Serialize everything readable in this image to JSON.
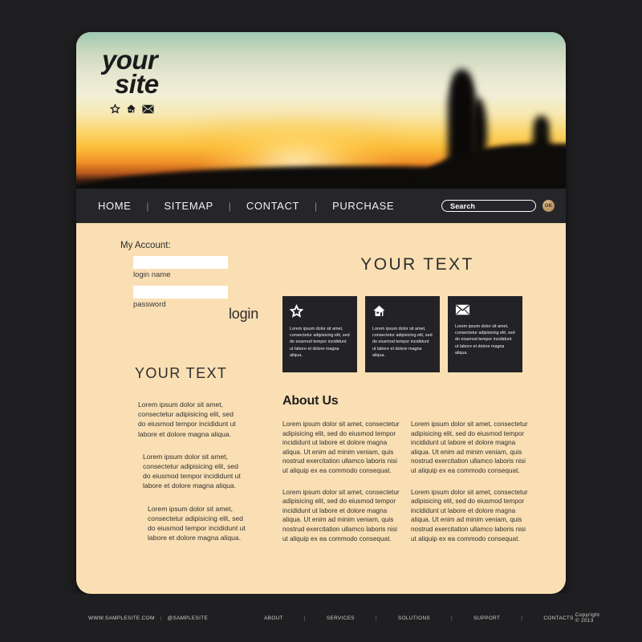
{
  "brand": {
    "line1": "your",
    "line2": "site",
    "icons": [
      "star-icon",
      "house-icon",
      "envelope-icon"
    ]
  },
  "nav": {
    "items": [
      "HOME",
      "SITEMAP",
      "CONTACT",
      "PURCHASE"
    ],
    "separator": "|",
    "search_placeholder": "Search",
    "ok_label": "OK"
  },
  "account": {
    "title": "My Account:",
    "login_value": "",
    "login_label": "login name",
    "password_value": "",
    "password_label": "password",
    "login_button": "login"
  },
  "left_column": {
    "heading": "YOUR  TEXT",
    "paragraphs": [
      "Lorem ipsum dolor sit amet, consectetur adipisicing elit, sed do eiusmod tempor incididunt ut labore et dolore magna aliqua.",
      "Lorem ipsum dolor sit amet, consectetur adipisicing elit, sed do eiusmod tempor incididunt ut labore et dolore magna aliqua.",
      "Lorem ipsum dolor sit amet, consectetur adipisicing elit, sed do eiusmod tempor incididunt ut labore et dolore magna aliqua."
    ]
  },
  "right_column": {
    "heading": "YOUR  TEXT",
    "features": [
      {
        "icon": "star-icon",
        "text": "Lorem ipsum dolor sit amet, consectetur adipisicing elit, sed do eiusmod tempor incididunt ut labore et dolore magna aliqua."
      },
      {
        "icon": "house-icon",
        "text": "Lorem ipsum dolor sit amet, consectetur adipisicing elit, sed do eiusmod tempor incididunt ut labore et dolore magna aliqua."
      },
      {
        "icon": "envelope-icon",
        "text": "Lorem ipsum dolor sit amet, consectetur adipisicing elit, sed do eiusmod tempor incididunt ut labore et dolore magna aliqua."
      }
    ],
    "about_heading": "About Us",
    "about_paragraphs": [
      "Lorem ipsum dolor sit amet, consectetur adipisicing elit, sed do eiusmod tempor incididunt ut labore et dolore magna aliqua. Ut enim ad minim veniam, quis nostrud exercitation ullamco laboris nisi ut aliquip ex ea commodo consequat.",
      "Lorem ipsum dolor sit amet, consectetur adipisicing elit, sed do eiusmod tempor incididunt ut labore et dolore magna aliqua. Ut enim ad minim veniam, quis nostrud exercitation ullamco laboris nisi ut aliquip ex ea commodo consequat.",
      "Lorem ipsum dolor sit amet, consectetur adipisicing elit, sed do eiusmod tempor incididunt ut labore et dolore magna aliqua. Ut enim ad minim veniam, quis nostrud exercitation ullamco laboris nisi ut aliquip ex ea commodo consequat.",
      "Lorem ipsum dolor sit amet, consectetur adipisicing elit, sed do eiusmod tempor incididunt ut labore et dolore magna aliqua. Ut enim ad minim veniam, quis nostrud exercitation ullamco laboris nisi ut aliquip ex ea commodo consequat."
    ]
  },
  "footer": {
    "site": "WWW.SAMPLESITE.COM",
    "divider": "|",
    "handle": "@SAMPLESITE",
    "links": [
      "ABOUT",
      "SERVICES",
      "SOLUTIONS",
      "SUPPORT",
      "CONTACTS"
    ],
    "link_separator": "|",
    "copyright": "Copyright © 2013"
  },
  "colors": {
    "page_background": "#1f1f21",
    "card_background": "#fadfb4",
    "navbar": "#26262a",
    "feature_box": "#232327",
    "accent_ok": "#bb9863",
    "text_dark": "#2d2d2d"
  }
}
